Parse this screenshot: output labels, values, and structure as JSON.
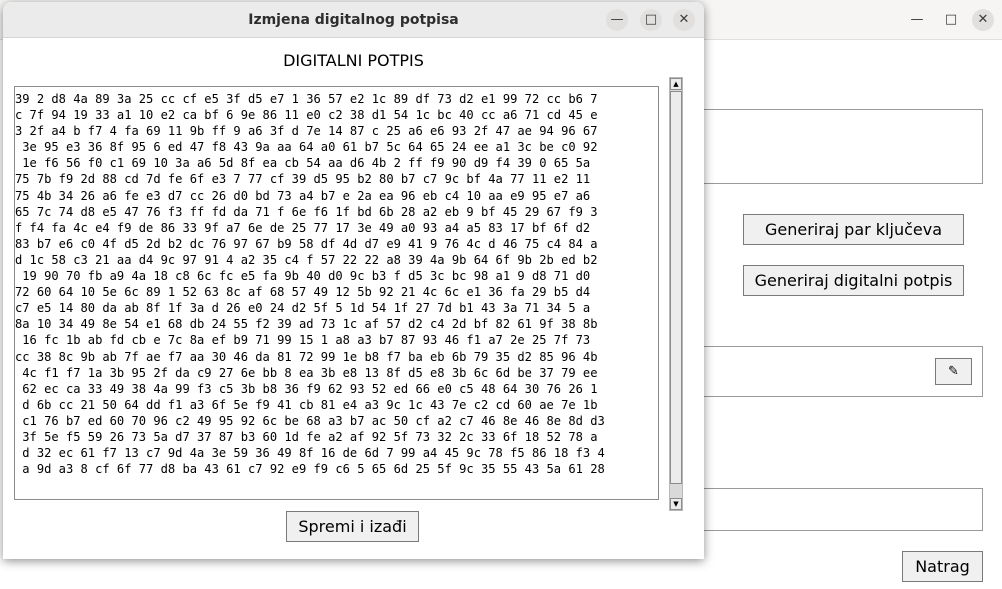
{
  "main_window": {
    "generate_keys_label": "Generiraj par ključeva",
    "generate_signature_label": "Generiraj digitalni potpis",
    "edit_icon_glyph": "✎",
    "back_label": "Natrag"
  },
  "dialog": {
    "title": "Izmjena digitalnog potpisa",
    "heading": "DIGITALNI POTPIS",
    "save_label": "Spremi i izađi",
    "signature_lines": [
      "39 2 d8 4a 89 3a 25 cc cf e5 3f d5 e7 1 36 57 e2 1c 89 df 73 d2 e1 99 72 cc b6 7",
      "c 7f 94 19 33 a1 10 e2 ca bf 6 9e 86 11 e0 c2 38 d1 54 1c bc 40 cc a6 71 cd 45 e",
      "3 2f a4 b f7 4 fa 69 11 9b ff 9 a6 3f d 7e 14 87 c 25 a6 e6 93 2f 47 ae 94 96 67",
      " 3e 95 e3 36 8f 95 6 ed 47 f8 43 9a aa 64 a0 61 b7 5c 64 65 24 ee a1 3c be c0 92",
      " 1e f6 56 f0 c1 69 10 3a a6 5d 8f ea cb 54 aa d6 4b 2 ff f9 90 d9 f4 39 0 65 5a",
      "75 7b f9 2d 88 cd 7d fe 6f e3 7 77 cf 39 d5 95 b2 80 b7 c7 9c bf 4a 77 11 e2 11",
      "75 4b 34 26 a6 fe e3 d7 cc 26 d0 bd 73 a4 b7 e 2a ea 96 eb c4 10 aa e9 95 e7 a6",
      "65 7c 74 d8 e5 47 76 f3 ff fd da 71 f 6e f6 1f bd 6b 28 a2 eb 9 bf 45 29 67 f9 3",
      "f f4 fa 4c e4 f9 de 86 33 9f a7 6e de 25 77 17 3e 49 a0 93 a4 a5 83 17 bf 6f d2",
      "83 b7 e6 c0 4f d5 2d b2 dc 76 97 67 b9 58 df 4d d7 e9 41 9 76 4c d 46 75 c4 84 a",
      "d 1c 58 c3 21 aa d4 9c 97 91 4 a2 35 c4 f 57 22 22 a8 39 4a 9b 64 6f 9b 2b ed b2",
      " 19 90 70 fb a9 4a 18 c8 6c fc e5 fa 9b 40 d0 9c b3 f d5 3c bc 98 a1 9 d8 71 d0",
      "72 60 64 10 5e 6c 89 1 52 63 8c af 68 57 49 12 5b 92 21 4c 6c e1 36 fa 29 b5 d4",
      "c7 e5 14 80 da ab 8f 1f 3a d 26 e0 24 d2 5f 5 1d 54 1f 27 7d b1 43 3a 71 34 5 a",
      "8a 10 34 49 8e 54 e1 68 db 24 55 f2 39 ad 73 1c af 57 d2 c4 2d bf 82 61 9f 38 8b",
      " 16 fc 1b ab fd cb e 7c 8a ef b9 71 99 15 1 a8 a3 b7 87 93 46 f1 a7 2e 25 7f 73",
      "cc 38 8c 9b ab 7f ae f7 aa 30 46 da 81 72 99 1e b8 f7 ba eb 6b 79 35 d2 85 96 4b",
      " 4c f1 f7 1a 3b 95 2f da c9 27 6e bb 8 ea 3b e8 13 8f d5 e8 3b 6c 6d be 37 79 ee",
      " 62 ec ca 33 49 38 4a 99 f3 c5 3b b8 36 f9 62 93 52 ed 66 e0 c5 48 64 30 76 26 1",
      " d 6b cc 21 50 64 dd f1 a3 6f 5e f9 41 cb 81 e4 a3 9c 1c 43 7e c2 cd 60 ae 7e 1b",
      " c1 76 b7 ed 60 70 96 c2 49 95 92 6c be 68 a3 b7 ac 50 cf a2 c7 46 8e 46 8e 8d d3",
      " 3f 5e f5 59 26 73 5a d7 37 87 b3 60 1d fe a2 af 92 5f 73 32 2c 33 6f 18 52 78 a",
      " d 32 ec 61 f7 13 c7 9d 4a 3e 59 36 49 8f 16 de 6d 7 99 a4 45 9c 78 f5 86 18 f3 4",
      " a 9d a3 8 cf 6f 77 d8 ba 43 61 c7 92 e9 f9 c6 5 65 6d 25 5f 9c 35 55 43 5a 61 28"
    ]
  }
}
